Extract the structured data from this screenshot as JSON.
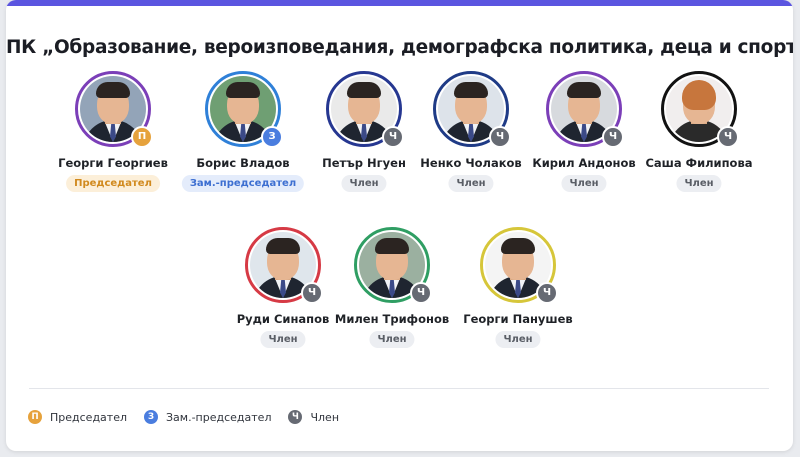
{
  "title": "ПК „Образование, вероизповедания, демографска политика, деца и спорт”",
  "colors": {
    "accent": "#5b55e0",
    "chair_badge": "#e6a23c",
    "chair_pill_bg": "#fcefd9",
    "chair_pill_text": "#d18a1e",
    "vice_badge": "#4a7ddf",
    "vice_pill_bg": "#e4ecfb",
    "vice_pill_text": "#3d6fd1",
    "member_badge": "#666a73",
    "member_pill_bg": "#eceef2",
    "member_pill_text": "#5a5e66"
  },
  "members": [
    {
      "name": "Георги Георгиев",
      "role": "Председател",
      "badge": "П",
      "ring": "#7b3fb8",
      "role_type": "chair",
      "bg": "#93a4b8"
    },
    {
      "name": "Борис Владов",
      "role": "Зам.-председател",
      "badge": "З",
      "ring": "#2f80d8",
      "role_type": "vice",
      "bg": "#6f9f73"
    },
    {
      "name": "Петър Нгуен",
      "role": "Член",
      "badge": "Ч",
      "ring": "#263791",
      "role_type": "member",
      "bg": "#eaeaea"
    },
    {
      "name": "Ненко Чолаков",
      "role": "Член",
      "badge": "Ч",
      "ring": "#1f3b86",
      "role_type": "member",
      "bg": "#dde3ea"
    },
    {
      "name": "Кирил Андонов",
      "role": "Член",
      "badge": "Ч",
      "ring": "#7b3fb8",
      "role_type": "member",
      "bg": "#d7dade"
    },
    {
      "name": "Саша Филипова",
      "role": "Член",
      "badge": "Ч",
      "ring": "#121212",
      "role_type": "member",
      "bg": "#f1eeee"
    },
    {
      "name": "Руди Синапов",
      "role": "Член",
      "badge": "Ч",
      "ring": "#d63a45",
      "role_type": "member",
      "bg": "#dfe6ec"
    },
    {
      "name": "Милен Трифонов",
      "role": "Член",
      "badge": "Ч",
      "ring": "#2f9e63",
      "role_type": "member",
      "bg": "#9bb0a0"
    },
    {
      "name": "Георги Панушев",
      "role": "Член",
      "badge": "Ч",
      "ring": "#d6c63a",
      "role_type": "member",
      "bg": "#f4f4f4"
    }
  ],
  "legend": [
    {
      "badge": "П",
      "label": "Председател",
      "role_type": "chair"
    },
    {
      "badge": "З",
      "label": "Зам.-председател",
      "role_type": "vice"
    },
    {
      "badge": "Ч",
      "label": "Член",
      "role_type": "member"
    }
  ]
}
